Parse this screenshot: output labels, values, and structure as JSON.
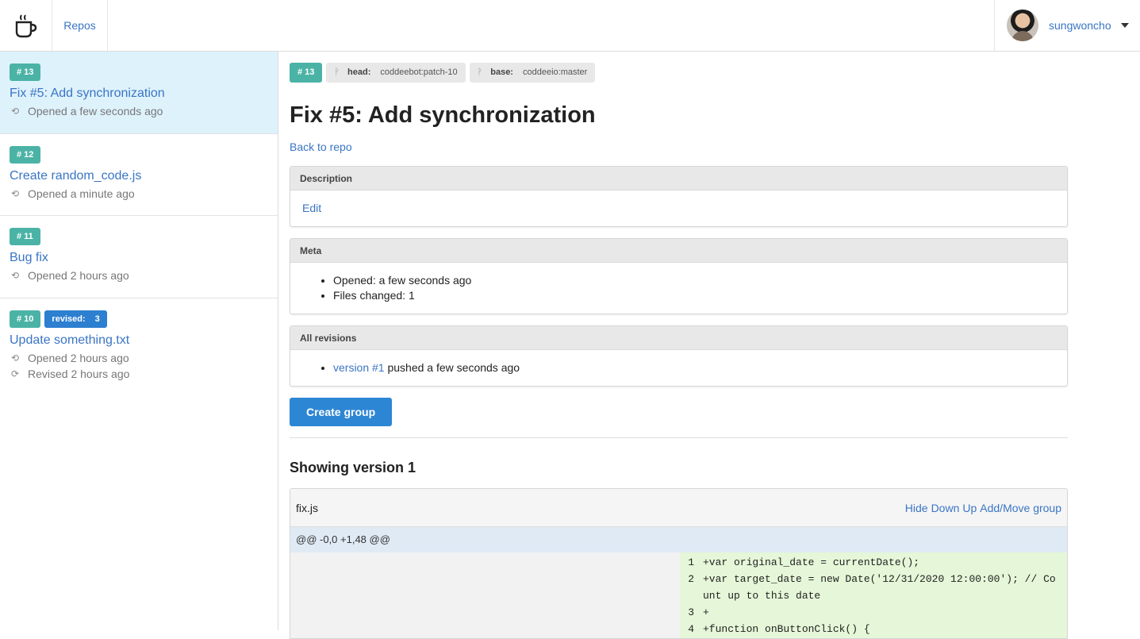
{
  "nav": {
    "logo_icon": "coffee-cup-icon",
    "repos_label": "Repos",
    "username": "sungwoncho"
  },
  "sidebar": {
    "items": [
      {
        "number": "# 13",
        "title": "Fix #5: Add synchronization",
        "opened": "Opened a few seconds ago",
        "active": true
      },
      {
        "number": "# 12",
        "title": "Create random_code.js",
        "opened": "Opened a minute ago"
      },
      {
        "number": "# 11",
        "title": "Bug fix",
        "opened": "Opened 2 hours ago"
      },
      {
        "number": "# 10",
        "revised_label": "revised:",
        "revised_count": "3",
        "title": "Update something.txt",
        "opened": "Opened 2 hours ago",
        "revised": "Revised 2 hours ago"
      }
    ]
  },
  "main": {
    "number": "# 13",
    "head_label": "head:",
    "head_value": "coddeebot:patch-10",
    "base_label": "base:",
    "base_value": "coddeeio:master",
    "title": "Fix #5: Add synchronization",
    "back_link": "Back to repo",
    "description": {
      "header": "Description",
      "edit": "Edit"
    },
    "meta": {
      "header": "Meta",
      "opened": "Opened: a few seconds ago",
      "files_changed": "Files changed: 1"
    },
    "revisions": {
      "header": "All revisions",
      "link": "version #1",
      "text": " pushed a few seconds ago"
    },
    "create_group": "Create group",
    "showing": "Showing version 1",
    "file": {
      "name": "fix.js",
      "actions": [
        "Hide",
        "Down",
        "Up",
        "Add/Move group"
      ],
      "hunk": "@@ -0,0 +1,48 @@",
      "lines": [
        {
          "n": "1",
          "code": "+var original_date = currentDate();"
        },
        {
          "n": "2",
          "code": "+var target_date = new Date('12/31/2020 12:00:00'); // Count up to this date"
        },
        {
          "n": "3",
          "code": "+"
        },
        {
          "n": "4",
          "code": "+function onButtonClick() {"
        }
      ]
    }
  },
  "colors": {
    "link": "#3a75c4",
    "badge_teal": "#4bb3a6",
    "badge_blue": "#2d7fd0",
    "active_bg": "#def2fc",
    "added_bg": "#e5f7d8"
  }
}
